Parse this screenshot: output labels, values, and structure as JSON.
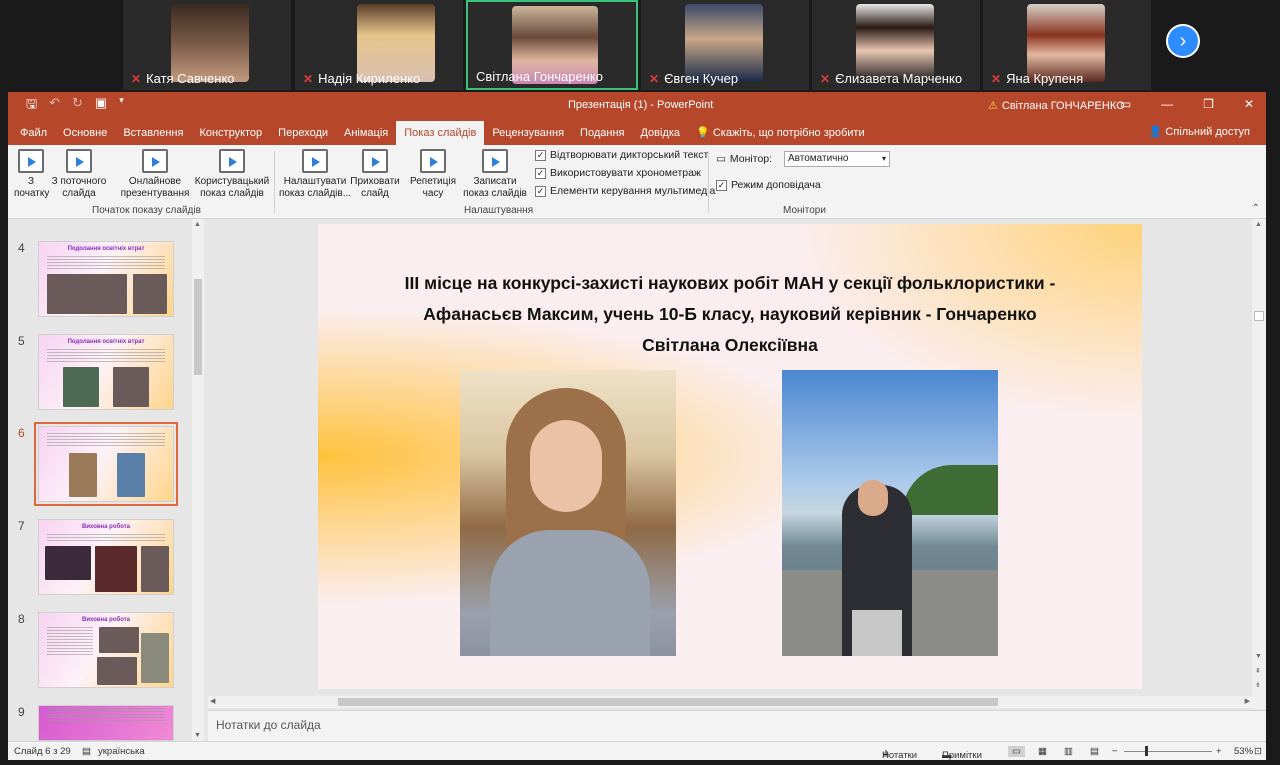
{
  "participants": [
    {
      "name": "Катя Савченко",
      "muted": true,
      "active": false
    },
    {
      "name": "Надія Кириленко",
      "muted": true,
      "active": false
    },
    {
      "name": "Світлана Гончаренко",
      "muted": false,
      "active": true
    },
    {
      "name": "Євген Кучер",
      "muted": true,
      "active": false
    },
    {
      "name": "Єлизавета Марченко",
      "muted": true,
      "active": false
    },
    {
      "name": "Яна Крупеня",
      "muted": true,
      "active": false
    }
  ],
  "window": {
    "title": "Презентація (1)  -  PowerPoint",
    "user": "Світлана ГОНЧАРЕНКО"
  },
  "tabs": [
    "Файл",
    "Основне",
    "Вставлення",
    "Конструктор",
    "Переходи",
    "Анімація",
    "Показ слайдів",
    "Рецензування",
    "Подання",
    "Довідка"
  ],
  "tell_me": "Скажіть, що потрібно зробити",
  "share": "Спільний доступ",
  "ribbon": {
    "from_start": "З початку",
    "from_current": "З поточного слайда",
    "online": "Онлайнове презентування",
    "custom": "Користувацький показ слайдів",
    "group_start": "Початок показу слайдів",
    "setup": "Налаштувати показ слайдів...",
    "hide": "Приховати слайд",
    "rehearse": "Репетиція часу",
    "record": "Записати показ слайдів",
    "chk_narration": "Відтворювати дикторський текст",
    "chk_timings": "Використовувати хронометраж",
    "chk_media": "Елементи керування мультимедіа",
    "group_setup": "Налаштування",
    "monitor_label": "Монітор:",
    "monitor_value": "Автоматично",
    "presenter_view": "Режим доповідача",
    "group_monitors": "Монітори"
  },
  "thumbnails": [
    {
      "num": "4",
      "title": "Подолання освітніх втрат"
    },
    {
      "num": "5",
      "title": "Подолання освітніх втрат"
    },
    {
      "num": "6",
      "title": ""
    },
    {
      "num": "7",
      "title": "Виховна робота"
    },
    {
      "num": "8",
      "title": "Виховна робота"
    },
    {
      "num": "9",
      "title": ""
    }
  ],
  "slide": {
    "title": "ІІІ місце на конкурсі-захисті наукових робіт МАН у секції фольклористики - Афанасьєв Максим, учень 10-Б класу, науковий керівник - Гончаренко Світлана Олексіївна"
  },
  "notes_placeholder": "Нотатки до слайда",
  "status": {
    "slide": "Слайд 6 з 29",
    "language": "українська",
    "notes": "Нотатки",
    "comments": "Примітки",
    "zoom": "53%"
  }
}
